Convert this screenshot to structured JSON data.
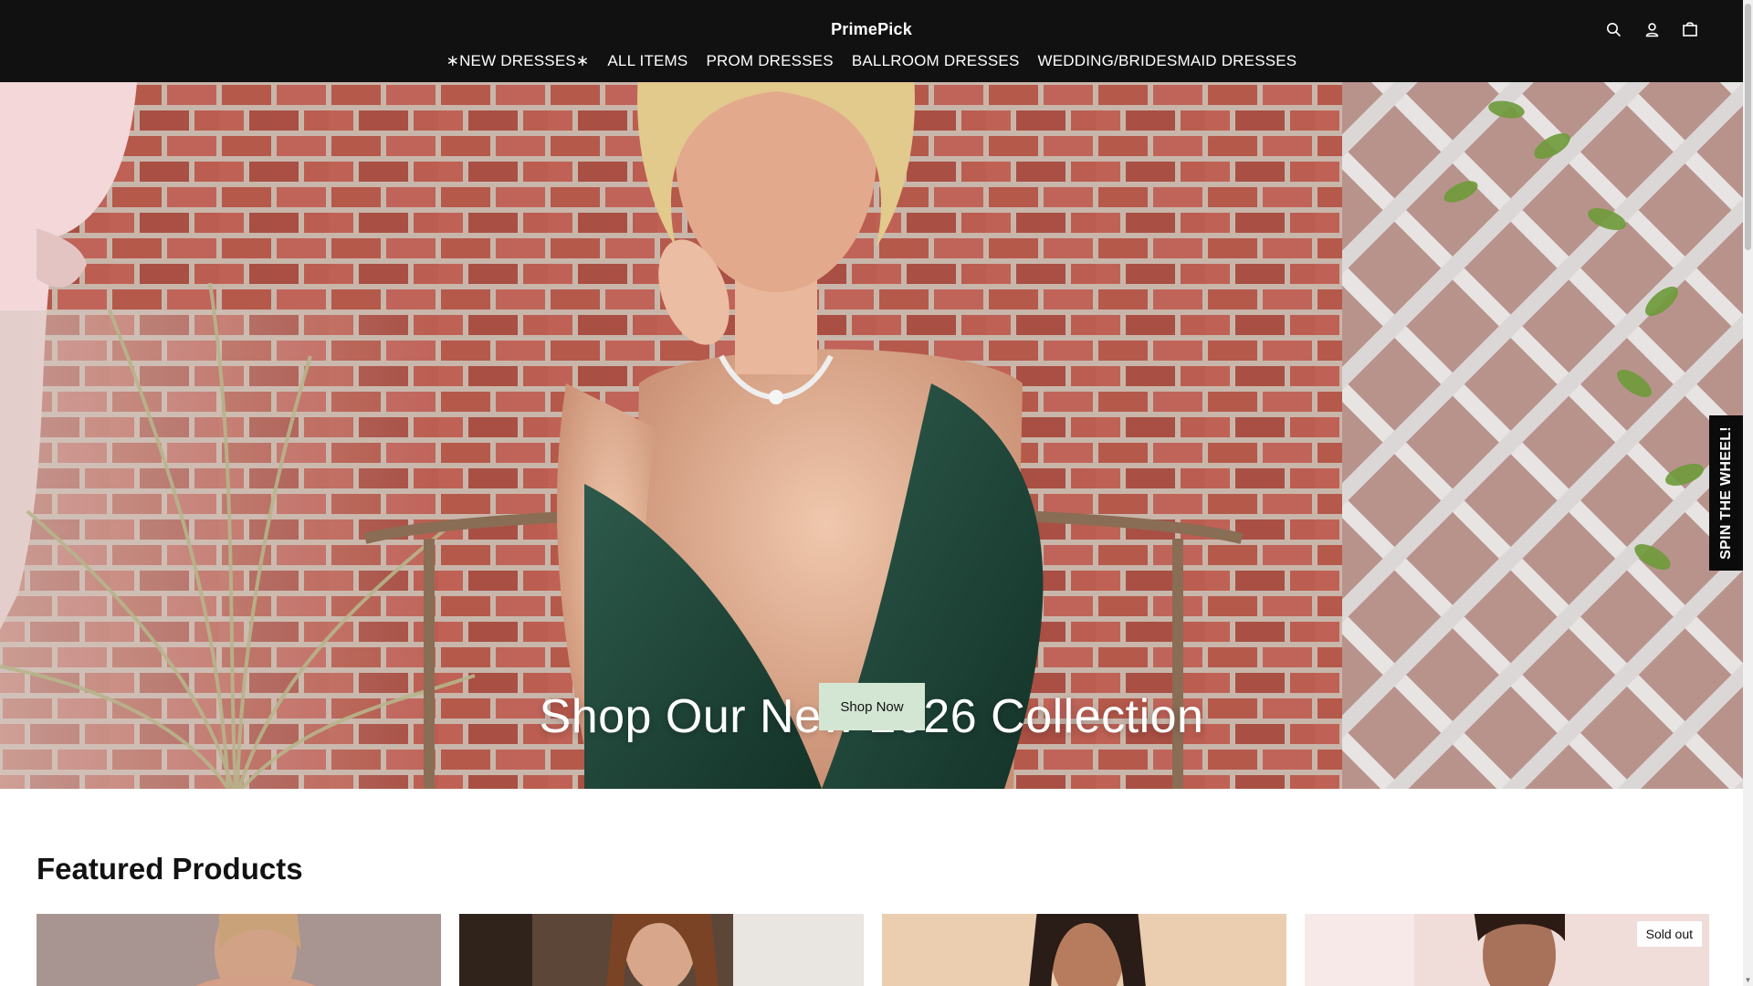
{
  "header": {
    "brand": "PrimePick",
    "nav": [
      {
        "label": "∗NEW DRESSES∗"
      },
      {
        "label": "ALL ITEMS"
      },
      {
        "label": "PROM DRESSES"
      },
      {
        "label": "BALLROOM DRESSES"
      },
      {
        "label": "WEDDING/BRIDESMAID DRESSES"
      }
    ],
    "icons": [
      "search-icon",
      "account-icon",
      "cart-icon"
    ]
  },
  "hero": {
    "title": "Shop Our New 2026 Collection",
    "button_label": "Shop Now"
  },
  "spin_tab": {
    "label": "SPIN THE WHEEL!"
  },
  "featured": {
    "title": "Featured Products",
    "products": [
      {
        "badge": ""
      },
      {
        "badge": ""
      },
      {
        "badge": ""
      },
      {
        "badge": "Sold out"
      }
    ]
  },
  "colors": {
    "header_bg": "#111111",
    "button_bg": "#d3e6d4",
    "spin_tab_bg": "#0b0b0b"
  }
}
